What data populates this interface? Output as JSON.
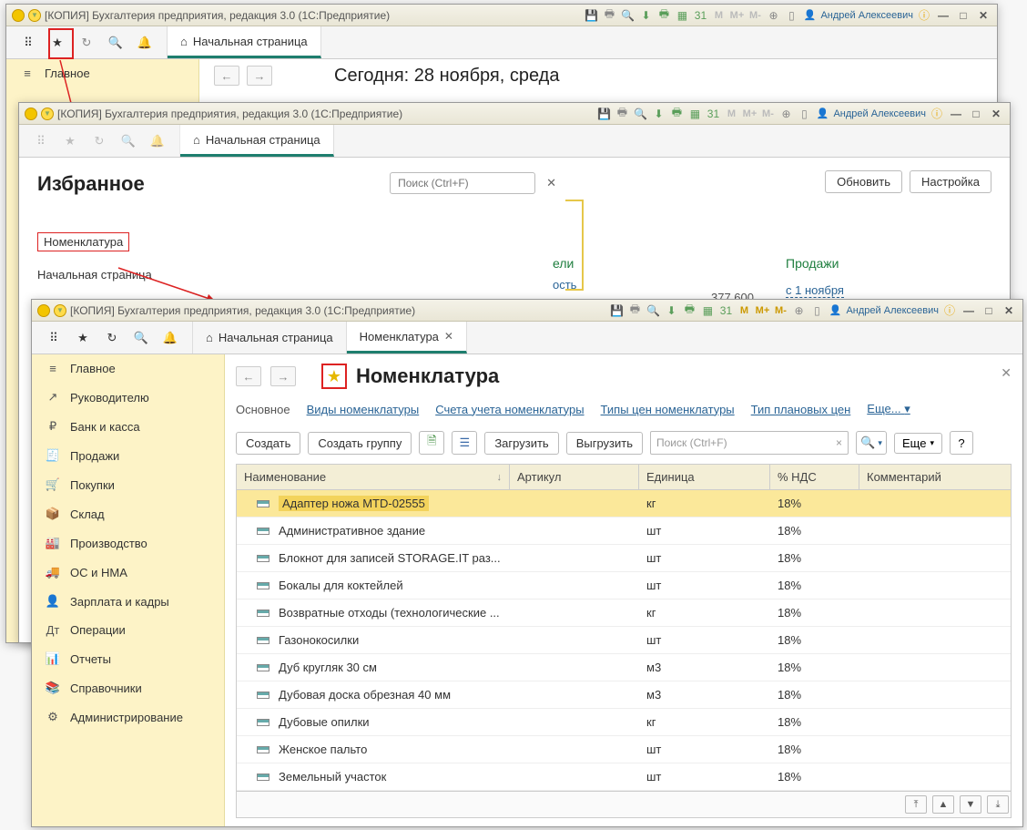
{
  "titlebar": {
    "app_title": "[КОПИЯ] Бухгалтерия предприятия, редакция 3.0  (1С:Предприятие)",
    "m_label": "M",
    "mplus_label": "M+",
    "mminus_label": "M-",
    "user_name": "Андрей Алексеевич"
  },
  "tabs": {
    "home": "Начальная страница",
    "nomenclature": "Номенклатура"
  },
  "window1": {
    "side_main": "Главное",
    "date_line": "Сегодня: 28 ноября, среда"
  },
  "window2": {
    "title": "Избранное",
    "search_placeholder": "Поиск (Ctrl+F)",
    "link_nomenclature": "Номенклатура",
    "link_home": "Начальная страница",
    "btn_refresh": "Обновить",
    "btn_settings": "Настройка",
    "sales_label": "Продажи",
    "since_label": "с 1 ноября",
    "partial_label": "ели",
    "partial_val": "377 600",
    "partial_word": "ость"
  },
  "window3": {
    "title": "Номенклатура",
    "breadcrumb": {
      "main": "Основное",
      "types": "Виды номенклатуры",
      "accounts": "Счета учета номенклатуры",
      "price_types": "Типы цен номенклатуры",
      "plan_price": "Тип плановых цен",
      "more": "Еще..."
    },
    "actions": {
      "create": "Создать",
      "create_group": "Создать группу",
      "load": "Загрузить",
      "unload": "Выгрузить",
      "find_placeholder": "Поиск (Ctrl+F)",
      "more": "Еще"
    },
    "columns": {
      "name": "Наименование",
      "article": "Артикул",
      "unit": "Единица",
      "vat": "% НДС",
      "comment": "Комментарий"
    },
    "rows": [
      {
        "name": "Адаптер ножа MTD-02555",
        "article": "",
        "unit": "кг",
        "vat": "18%"
      },
      {
        "name": "Административное здание",
        "article": "",
        "unit": "шт",
        "vat": "18%"
      },
      {
        "name": "Блокнот для записей STORAGE.IT раз...",
        "article": "",
        "unit": "шт",
        "vat": "18%"
      },
      {
        "name": "Бокалы для коктейлей",
        "article": "",
        "unit": "шт",
        "vat": "18%"
      },
      {
        "name": "Возвратные отходы (технологические ...",
        "article": "",
        "unit": "кг",
        "vat": "18%"
      },
      {
        "name": "Газонокосилки",
        "article": "",
        "unit": "шт",
        "vat": "18%"
      },
      {
        "name": "Дуб кругляк 30 см",
        "article": "",
        "unit": "м3",
        "vat": "18%"
      },
      {
        "name": "Дубовая доска обрезная 40 мм",
        "article": "",
        "unit": "м3",
        "vat": "18%"
      },
      {
        "name": "Дубовые опилки",
        "article": "",
        "unit": "кг",
        "vat": "18%"
      },
      {
        "name": "Женское пальто",
        "article": "",
        "unit": "шт",
        "vat": "18%"
      },
      {
        "name": "Земельный участок",
        "article": "",
        "unit": "шт",
        "vat": "18%"
      }
    ],
    "sidebar": [
      "Главное",
      "Руководителю",
      "Банк и касса",
      "Продажи",
      "Покупки",
      "Склад",
      "Производство",
      "ОС и НМА",
      "Зарплата и кадры",
      "Операции",
      "Отчеты",
      "Справочники",
      "Администрирование"
    ]
  }
}
